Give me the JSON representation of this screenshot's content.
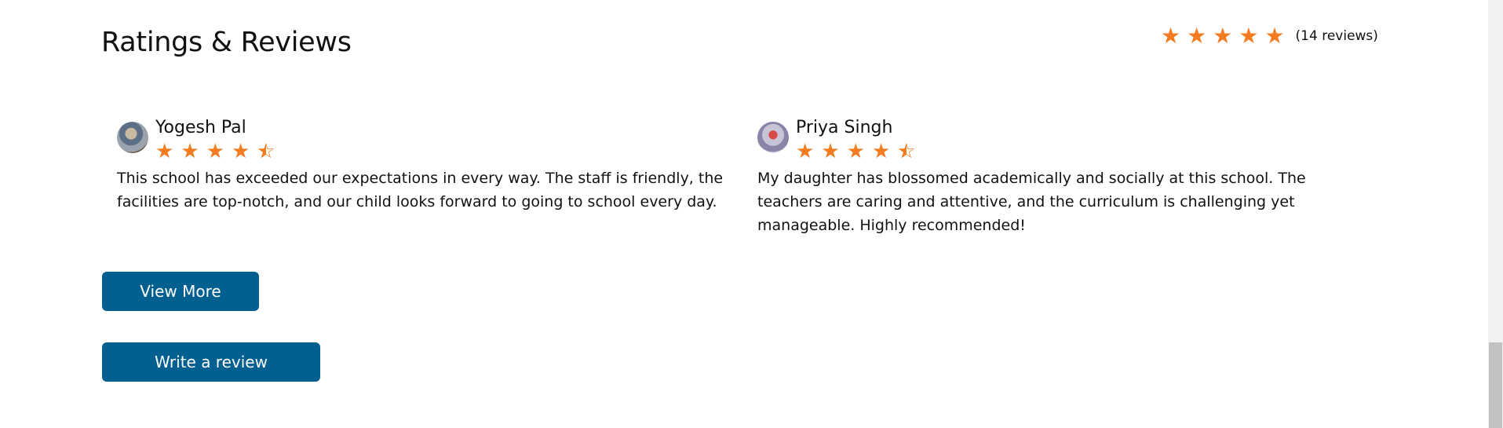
{
  "colors": {
    "star": "#F47B20",
    "button": "#01608F"
  },
  "heading": "Ratings & Reviews",
  "summary": {
    "stars": 5,
    "count_label": "(14 reviews)"
  },
  "reviews": [
    {
      "name": "Yogesh Pal",
      "rating": 4.5,
      "avatar": "user-photo-icon",
      "text": "This school has exceeded our expectations in every way. The staff is friendly, the facilities are top-notch, and our child looks forward to going to school every day."
    },
    {
      "name": "Priya Singh",
      "rating": 4.5,
      "avatar": "user-photo-icon",
      "text": "My daughter has blossomed academically and socially at this school. The teachers are caring and attentive, and the curriculum is challenging yet manageable. Highly recommended!"
    }
  ],
  "buttons": {
    "view_more": "View More",
    "write_review": "Write a review"
  }
}
